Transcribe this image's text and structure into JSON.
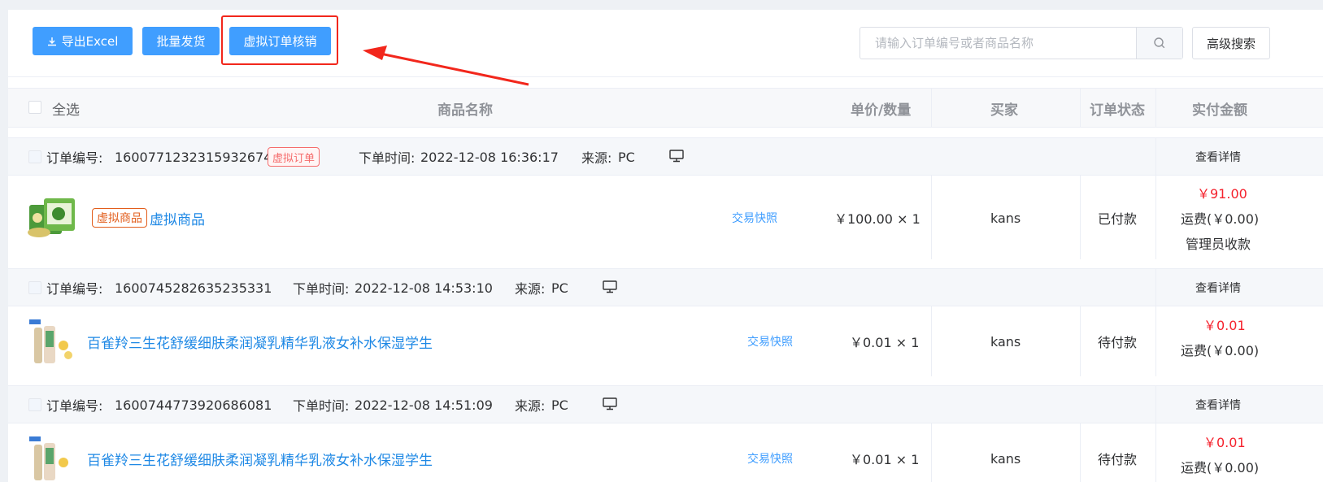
{
  "toolbar": {
    "export_label": "导出Excel",
    "batch_ship_label": "批量发货",
    "virtual_verify_label": "虚拟订单核销",
    "search_placeholder": "请输入订单编号或者商品名称",
    "advanced_search_label": "高级搜索"
  },
  "table_header": {
    "select_all": "全选",
    "product_name": "商品名称",
    "price_qty": "单价/数量",
    "buyer": "买家",
    "status": "订单状态",
    "paid": "实付金额"
  },
  "orders": [
    {
      "order_no_label": "订单编号:",
      "order_no": "1600771232315932674",
      "order_tag": "虚拟订单",
      "time_label": "下单时间:",
      "time": "2022-12-08 16:36:17",
      "source_label": "来源:",
      "source": "PC",
      "detail_link": "查看详情",
      "product_tag": "虚拟商品",
      "product_name": "虚拟商品",
      "snapshot": "交易快照",
      "price_qty": "￥100.00 × 1",
      "buyer": "kans",
      "status": "已付款",
      "paid_amount": "￥91.00",
      "shipping": "运费(￥0.00)",
      "payment_note": "管理员收款"
    },
    {
      "order_no_label": "订单编号:",
      "order_no": "1600745282635235331",
      "time_label": "下单时间:",
      "time": "2022-12-08 14:53:10",
      "source_label": "来源:",
      "source": "PC",
      "detail_link": "查看详情",
      "product_name": "百雀羚三生花舒缓细肤柔润凝乳精华乳液女补水保湿学生",
      "snapshot": "交易快照",
      "price_qty": "￥0.01 × 1",
      "buyer": "kans",
      "status": "待付款",
      "paid_amount": "￥0.01",
      "shipping": "运费(￥0.00)"
    },
    {
      "order_no_label": "订单编号:",
      "order_no": "1600744773920686081",
      "time_label": "下单时间:",
      "time": "2022-12-08 14:51:09",
      "source_label": "来源:",
      "source": "PC",
      "detail_link": "查看详情",
      "product_name": "百雀羚三生花舒缓细肤柔润凝乳精华乳液女补水保湿学生",
      "snapshot": "交易快照",
      "price_qty": "￥0.01 × 1",
      "buyer": "kans",
      "status": "待付款",
      "paid_amount": "￥0.01",
      "shipping": "运费(￥0.00)"
    }
  ],
  "colors": {
    "primary": "#409eff",
    "highlight": "#f2271c",
    "price_red": "#f5222d",
    "link": "#1e88e5"
  },
  "icons": [
    "download-icon",
    "search-icon",
    "monitor-icon",
    "arrow-annotation"
  ]
}
